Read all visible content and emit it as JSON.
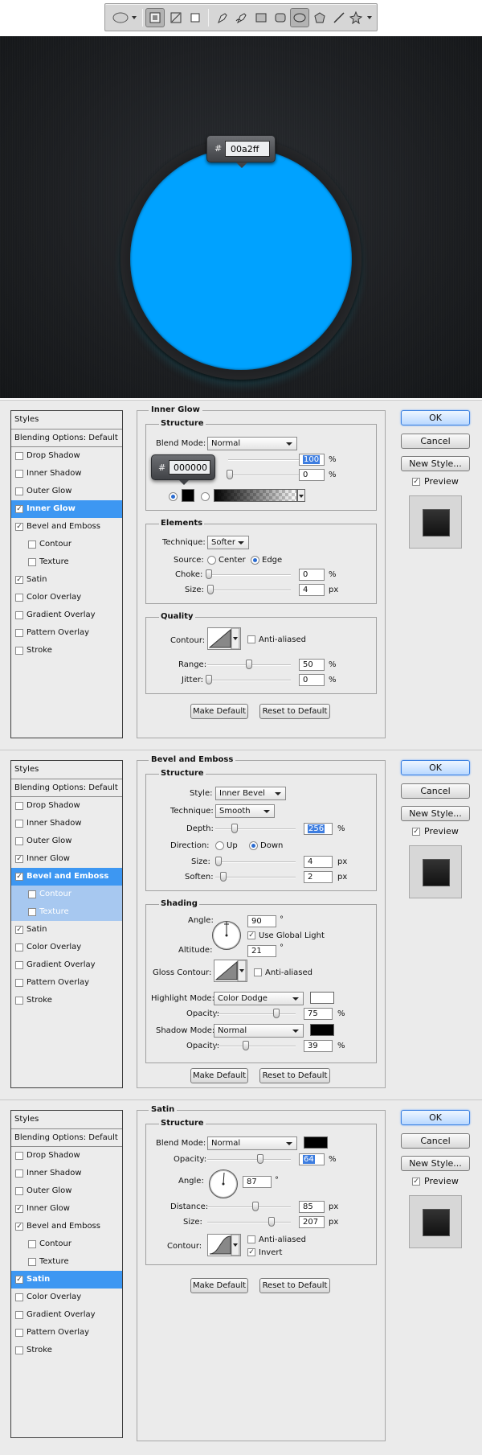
{
  "toolbar": {
    "tools": [
      {
        "icon": "ellipse-shape-icon"
      },
      {
        "icon": "shape-layers-icon"
      },
      {
        "icon": "paths-icon"
      },
      {
        "icon": "fill-pixels-icon"
      },
      {
        "icon": "pen-icon"
      },
      {
        "icon": "freeform-pen-icon"
      },
      {
        "icon": "rectangle-icon"
      },
      {
        "icon": "rounded-rectangle-icon"
      },
      {
        "icon": "ellipse-icon"
      },
      {
        "icon": "polygon-icon"
      },
      {
        "icon": "line-icon"
      },
      {
        "icon": "custom-shape-icon"
      }
    ]
  },
  "canvas": {
    "hash": "#",
    "color_value": "00a2ff",
    "circle_color": "#00a2ff"
  },
  "common": {
    "ok": "OK",
    "cancel": "Cancel",
    "new_style": "New Style...",
    "preview": "Preview",
    "make_default": "Make Default",
    "reset_to_default": "Reset to Default",
    "styles": "Styles",
    "blending_options": "Blending Options: Default"
  },
  "panels": [
    {
      "styles_list": [
        {
          "label": "Drop Shadow",
          "checked": false
        },
        {
          "label": "Inner Shadow",
          "checked": false
        },
        {
          "label": "Outer Glow",
          "checked": false
        },
        {
          "label": "Inner Glow",
          "checked": true,
          "selected": true
        },
        {
          "label": "Bevel and Emboss",
          "checked": true
        },
        {
          "label": "Contour",
          "checked": false,
          "sub": true
        },
        {
          "label": "Texture",
          "checked": false,
          "sub": true
        },
        {
          "label": "Satin",
          "checked": true
        },
        {
          "label": "Color Overlay",
          "checked": false
        },
        {
          "label": "Gradient Overlay",
          "checked": false
        },
        {
          "label": "Pattern Overlay",
          "checked": false
        },
        {
          "label": "Stroke",
          "checked": false
        }
      ],
      "title": "Inner Glow",
      "structure": {
        "title": "Structure",
        "blend_mode_label": "Blend Mode:",
        "blend_mode": "Normal",
        "opacity_value": "100",
        "noise_value": "0",
        "percent": "%",
        "color_popup_hash": "#",
        "color_popup_value": "000000"
      },
      "elements": {
        "title": "Elements",
        "technique_label": "Technique:",
        "technique": "Softer",
        "source_label": "Source:",
        "center": "Center",
        "edge": "Edge",
        "choke_label": "Choke:",
        "choke_value": "0",
        "choke_unit": "%",
        "size_label": "Size:",
        "size_value": "4",
        "size_unit": "px"
      },
      "quality": {
        "title": "Quality",
        "contour_label": "Contour:",
        "anti_aliased": "Anti-aliased",
        "range_label": "Range:",
        "range_value": "50",
        "range_unit": "%",
        "jitter_label": "Jitter:",
        "jitter_value": "0",
        "jitter_unit": "%"
      }
    },
    {
      "styles_list": [
        {
          "label": "Drop Shadow",
          "checked": false
        },
        {
          "label": "Inner Shadow",
          "checked": false
        },
        {
          "label": "Outer Glow",
          "checked": false
        },
        {
          "label": "Inner Glow",
          "checked": true
        },
        {
          "label": "Bevel and Emboss",
          "checked": true,
          "selected": true
        },
        {
          "label": "Contour",
          "checked": false,
          "sub": true,
          "subsel": true
        },
        {
          "label": "Texture",
          "checked": false,
          "sub": true,
          "subsel": true
        },
        {
          "label": "Satin",
          "checked": true
        },
        {
          "label": "Color Overlay",
          "checked": false
        },
        {
          "label": "Gradient Overlay",
          "checked": false
        },
        {
          "label": "Pattern Overlay",
          "checked": false
        },
        {
          "label": "Stroke",
          "checked": false
        }
      ],
      "title": "Bevel and Emboss",
      "structure": {
        "title": "Structure",
        "style_label": "Style:",
        "style": "Inner Bevel",
        "technique_label": "Technique:",
        "technique": "Smooth",
        "depth_label": "Depth:",
        "depth_value": "256",
        "depth_unit": "%",
        "direction_label": "Direction:",
        "up": "Up",
        "down": "Down",
        "size_label": "Size:",
        "size_value": "4",
        "size_unit": "px",
        "soften_label": "Soften:",
        "soften_value": "2",
        "soften_unit": "px"
      },
      "shading": {
        "title": "Shading",
        "angle_label": "Angle:",
        "angle_value": "90",
        "degree": "°",
        "use_global_light": "Use Global Light",
        "altitude_label": "Altitude:",
        "altitude_value": "21",
        "gloss_contour_label": "Gloss Contour:",
        "anti_aliased": "Anti-aliased",
        "highlight_mode_label": "Highlight Mode:",
        "highlight_mode": "Color Dodge",
        "highlight_opacity_label": "Opacity:",
        "highlight_opacity_value": "75",
        "shadow_mode_label": "Shadow Mode:",
        "shadow_mode": "Normal",
        "shadow_opacity_label": "Opacity:",
        "shadow_opacity_value": "39",
        "percent": "%"
      }
    },
    {
      "styles_list": [
        {
          "label": "Drop Shadow",
          "checked": false
        },
        {
          "label": "Inner Shadow",
          "checked": false
        },
        {
          "label": "Outer Glow",
          "checked": false
        },
        {
          "label": "Inner Glow",
          "checked": true
        },
        {
          "label": "Bevel and Emboss",
          "checked": true
        },
        {
          "label": "Contour",
          "checked": false,
          "sub": true
        },
        {
          "label": "Texture",
          "checked": false,
          "sub": true
        },
        {
          "label": "Satin",
          "checked": true,
          "selected": true
        },
        {
          "label": "Color Overlay",
          "checked": false
        },
        {
          "label": "Gradient Overlay",
          "checked": false
        },
        {
          "label": "Pattern Overlay",
          "checked": false
        },
        {
          "label": "Stroke",
          "checked": false
        }
      ],
      "title": "Satin",
      "structure": {
        "title": "Structure",
        "blend_mode_label": "Blend Mode:",
        "blend_mode": "Normal",
        "opacity_label": "Opacity:",
        "opacity_value": "64",
        "percent": "%",
        "angle_label": "Angle:",
        "angle_value": "87",
        "degree": "°",
        "distance_label": "Distance:",
        "distance_value": "85",
        "distance_unit": "px",
        "size_label": "Size:",
        "size_value": "207",
        "size_unit": "px",
        "contour_label": "Contour:",
        "anti_aliased": "Anti-aliased",
        "invert": "Invert"
      }
    }
  ]
}
